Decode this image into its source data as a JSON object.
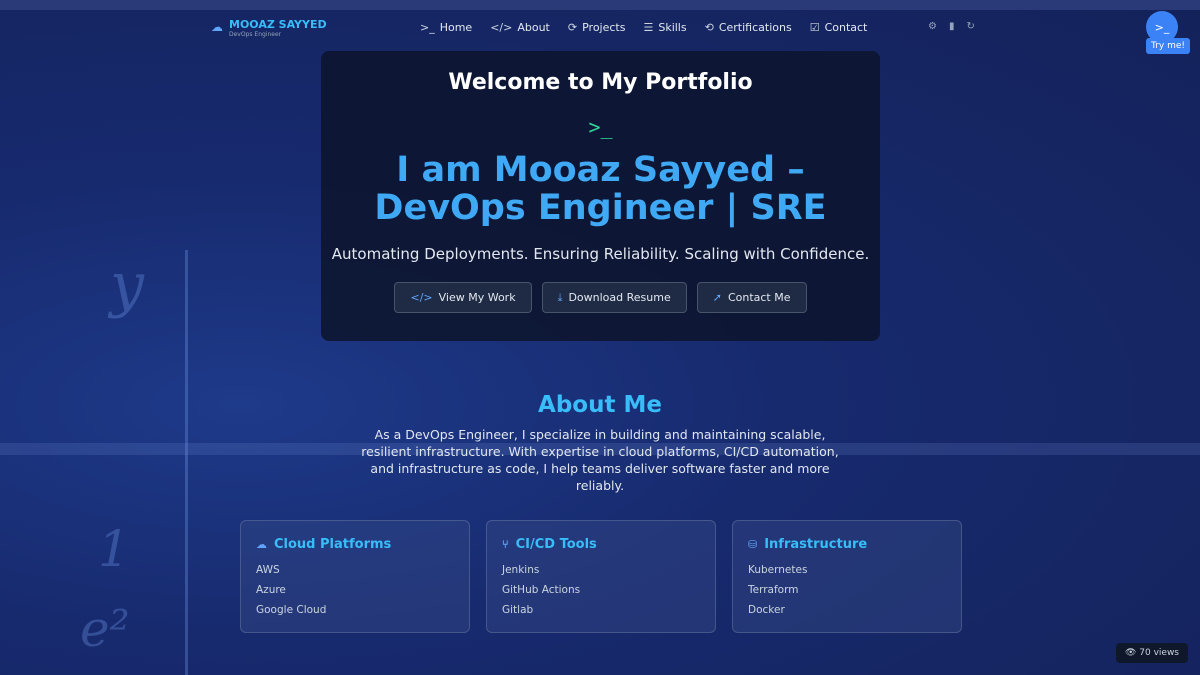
{
  "brand": {
    "name": "MOOAZ SAYYED",
    "subtitle": "DevOps Engineer",
    "icon": "cloud-icon"
  },
  "nav": [
    {
      "label": "Home",
      "icon": ">_"
    },
    {
      "label": "About",
      "icon": "</>"
    },
    {
      "label": "Projects",
      "icon": "⟳"
    },
    {
      "label": "Skills",
      "icon": "☰"
    },
    {
      "label": "Certifications",
      "icon": "⟲"
    },
    {
      "label": "Contact",
      "icon": "☑"
    }
  ],
  "utility_icons": [
    "⚙",
    "▮",
    "↻"
  ],
  "try": {
    "icon": ">_",
    "label": "Try me!"
  },
  "hero": {
    "welcome": "Welcome to My Portfolio",
    "prompt": ">_",
    "title_line1": "I am Mooaz Sayyed –",
    "title_line2": "DevOps Engineer | SRE",
    "tagline": "Automating Deployments. Ensuring Reliability. Scaling with Confidence.",
    "buttons": [
      {
        "label": "View My Work",
        "icon": "</>"
      },
      {
        "label": "Download Resume",
        "icon": "⤓"
      },
      {
        "label": "Contact Me",
        "icon": "➚"
      }
    ]
  },
  "about": {
    "title": "About Me",
    "text": "As a DevOps Engineer, I specialize in building and maintaining scalable, resilient infrastructure. With expertise in cloud platforms, CI/CD automation, and infrastructure as code, I help teams deliver software faster and more reliably."
  },
  "cards": [
    {
      "title": "Cloud Platforms",
      "icon": "☁",
      "items": [
        "AWS",
        "Azure",
        "Google Cloud"
      ]
    },
    {
      "title": "CI/CD Tools",
      "icon": "⑂",
      "items": [
        "Jenkins",
        "GitHub Actions",
        "Gitlab"
      ]
    },
    {
      "title": "Infrastructure",
      "icon": "⛁",
      "items": [
        "Kubernetes",
        "Terraform",
        "Docker"
      ]
    }
  ],
  "views": {
    "icon": "👁",
    "label": "70 views"
  }
}
